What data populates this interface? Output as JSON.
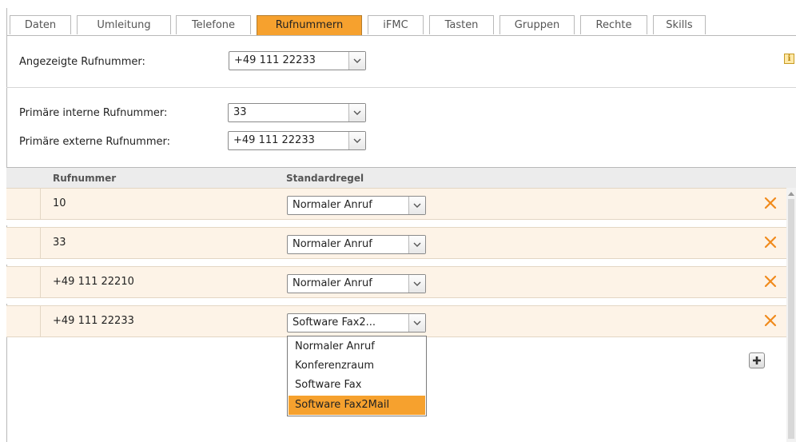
{
  "tabs": [
    {
      "label": "Daten"
    },
    {
      "label": "Umleitung"
    },
    {
      "label": "Telefone"
    },
    {
      "label": "Rufnummern"
    },
    {
      "label": "iFMC"
    },
    {
      "label": "Tasten"
    },
    {
      "label": "Gruppen"
    },
    {
      "label": "Rechte"
    },
    {
      "label": "Skills"
    }
  ],
  "active_tab": "Rufnummern",
  "displayed": {
    "label": "Angezeigte Rufnummer:",
    "value": "+49 111 22233"
  },
  "primary_internal": {
    "label": "Primäre interne Rufnummer:",
    "value": "33"
  },
  "primary_external": {
    "label": "Primäre externe Rufnummer:",
    "value": "+49 111 22233"
  },
  "table": {
    "headers": {
      "number": "Rufnummer",
      "rule": "Standardregel"
    },
    "rows": [
      {
        "number": "10",
        "rule": "Normaler Anruf"
      },
      {
        "number": "33",
        "rule": "Normaler Anruf"
      },
      {
        "number": "+49 111 22210",
        "rule": "Normaler Anruf"
      },
      {
        "number": "+49 111 22233",
        "rule": "Software Fax2..."
      }
    ]
  },
  "dropdown": {
    "options": [
      "Normaler Anruf",
      "Konferenzraum",
      "Software Fax",
      "Software Fax2Mail"
    ],
    "selected": "Software Fax2Mail"
  },
  "info_icon": "i",
  "colors": {
    "accent": "#f6a12e",
    "row_bg": "#fdf3e7",
    "delete": "#f08a1c"
  },
  "icons": {
    "delete": "close-x-icon",
    "add": "plus-icon",
    "info": "info-icon",
    "dropdown": "chevron-down-icon"
  }
}
